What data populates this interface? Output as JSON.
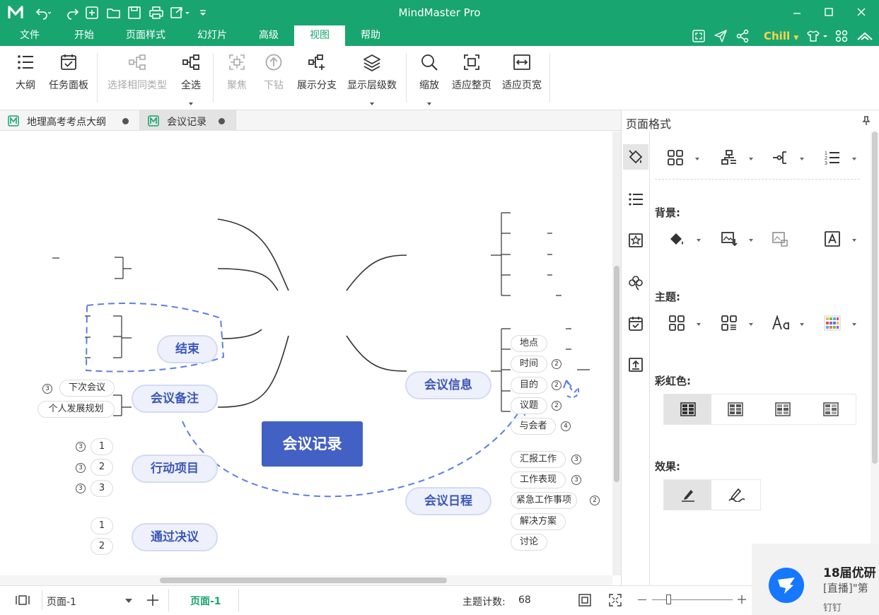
{
  "app": {
    "title": "MindMaster Pro"
  },
  "menu": {
    "items": [
      "文件",
      "开始",
      "页面样式",
      "幻灯片",
      "高级",
      "视图",
      "帮助"
    ],
    "active": "视图",
    "theme_label": "Chill"
  },
  "ribbon": {
    "buttons": [
      "大纲",
      "任务面板",
      "选择相同类型",
      "全选",
      "聚焦",
      "下钻",
      "展示分支",
      "显示层级数",
      "缩放",
      "适应整页",
      "适应页宽"
    ]
  },
  "doc_tabs": [
    "地理高考考点大纲",
    "会议记录"
  ],
  "mindmap": {
    "central": "会议记录",
    "left_topics": [
      "结束",
      "会议备注",
      "行动项目",
      "通过决议"
    ],
    "right_topics": [
      "会议信息",
      "会议日程"
    ],
    "notes_children": [
      "下次会议",
      "个人发展规划"
    ],
    "notes_badge": "3",
    "action_children": [
      "1",
      "2",
      "3"
    ],
    "action_badges": [
      "3",
      "3",
      "3"
    ],
    "resolution_children": [
      "1",
      "2"
    ],
    "info_children": [
      "地点",
      "时间",
      "目的",
      "议题",
      "与会者"
    ],
    "info_badges": [
      "2",
      "2",
      "2",
      "4"
    ],
    "agenda_children": [
      "汇报工作",
      "工作表现",
      "紧急工作事项",
      "解决方案",
      "讨论"
    ],
    "agenda_badges": [
      "3",
      "3",
      "2"
    ]
  },
  "panel": {
    "title": "页面格式",
    "sections": [
      "背景:",
      "主题:",
      "彩虹色:",
      "效果:"
    ]
  },
  "status": {
    "page_select": "页面-1",
    "page_tab": "页面-1",
    "topic_count_label": "主题计数:",
    "topic_count": "68"
  },
  "notification": {
    "title": "18届优研",
    "subtitle": "[直播]\"第",
    "source": "钉钉"
  },
  "colors": {
    "brand": "#19a56f",
    "central": "#4360c4",
    "topic_text": "#3d57b8",
    "relationship": "#5b7fe0"
  }
}
